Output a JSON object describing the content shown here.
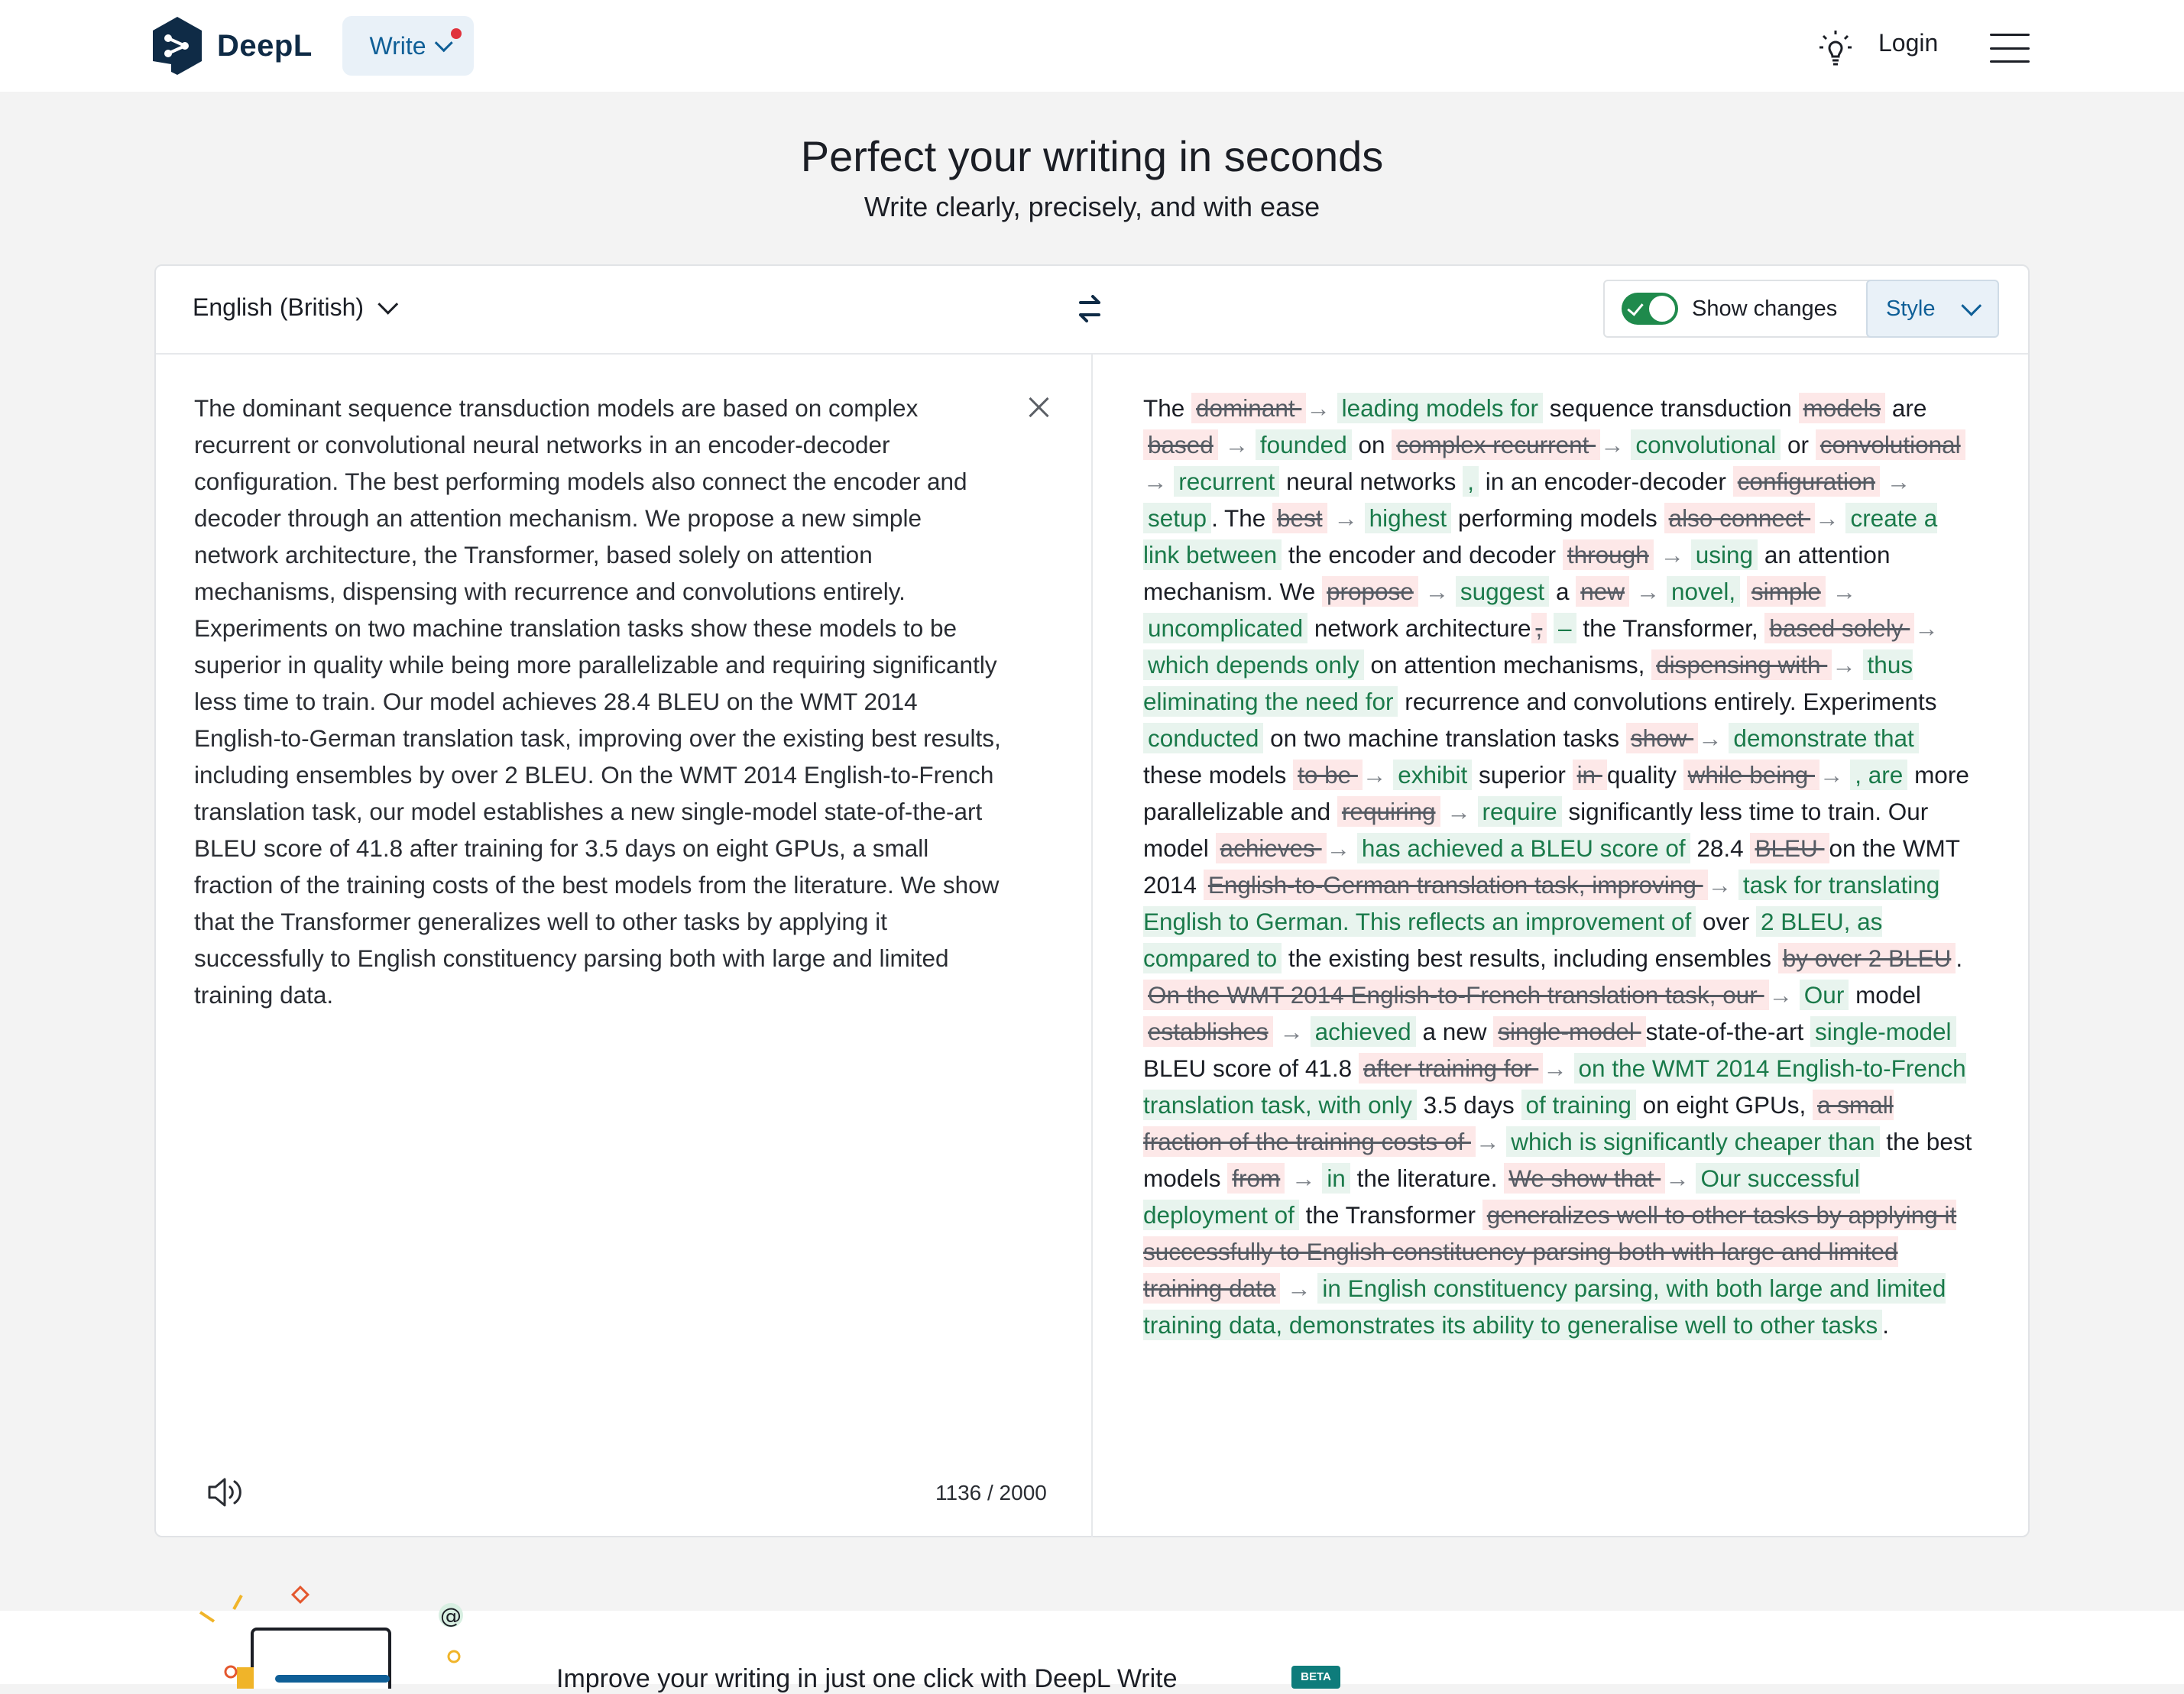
{
  "header": {
    "brand": "DeepL",
    "write_label": "Write",
    "login_label": "Login"
  },
  "hero": {
    "title": "Perfect your writing in seconds",
    "subtitle": "Write clearly, precisely, and with ease"
  },
  "editor": {
    "language": "English (British)",
    "show_changes_label": "Show changes",
    "show_changes_on": true,
    "style_label": "Style",
    "source_text": "The dominant sequence transduction models are based on complex recurrent or convolutional neural networks in an encoder-decoder configuration. The best performing models also connect the encoder and decoder through an attention mechanism. We propose a new simple network architecture, the Transformer, based solely on attention mechanisms, dispensing with recurrence and convolutions entirely. Experiments on two machine translation tasks show these models to be superior in quality while being more parallelizable and requiring significantly less time to train. Our model achieves 28.4 BLEU on the WMT 2014 English-to-German translation task, improving over the existing best results, including ensembles by over 2 BLEU. On the WMT 2014 English-to-French translation task, our model establishes a new single-model state-of-the-art BLEU score of 41.8 after training for 3.5 days on eight GPUs, a small fraction of the training costs of the best models from the literature. We show that the Transformer generalizes well to other tasks by applying it successfully to English constituency parsing both with large and limited training data.",
    "char_count": "1136 / 2000",
    "result_segments": [
      {
        "t": "plain",
        "text": "The "
      },
      {
        "t": "del",
        "text": "dominant "
      },
      {
        "t": "arrow",
        "text": " → "
      },
      {
        "t": "ins",
        "text": "leading models for"
      },
      {
        "t": "plain",
        "text": " sequence transduction "
      },
      {
        "t": "del",
        "text": "models"
      },
      {
        "t": "plain",
        "text": " are "
      },
      {
        "t": "del",
        "text": "based"
      },
      {
        "t": "arrow",
        "text": " → "
      },
      {
        "t": "ins",
        "text": "founded"
      },
      {
        "t": "plain",
        "text": " on "
      },
      {
        "t": "del",
        "text": "complex recurrent "
      },
      {
        "t": "arrow",
        "text": " → "
      },
      {
        "t": "ins",
        "text": "convolutional"
      },
      {
        "t": "plain",
        "text": " or "
      },
      {
        "t": "del",
        "text": "convolutional"
      },
      {
        "t": "arrow",
        "text": " → "
      },
      {
        "t": "ins",
        "text": "recurrent"
      },
      {
        "t": "plain",
        "text": " neural networks "
      },
      {
        "t": "ins",
        "text": ","
      },
      {
        "t": "plain",
        "text": " in an encoder-decoder "
      },
      {
        "t": "del",
        "text": "configuration"
      },
      {
        "t": "arrow",
        "text": " → "
      },
      {
        "t": "ins",
        "text": "setup"
      },
      {
        "t": "plain",
        "text": ". The "
      },
      {
        "t": "del",
        "text": "best"
      },
      {
        "t": "arrow",
        "text": " → "
      },
      {
        "t": "ins",
        "text": "highest"
      },
      {
        "t": "plain",
        "text": " performing models "
      },
      {
        "t": "del",
        "text": "also connect "
      },
      {
        "t": "arrow",
        "text": " → "
      },
      {
        "t": "ins",
        "text": "create a link between"
      },
      {
        "t": "plain",
        "text": " the encoder and decoder "
      },
      {
        "t": "del",
        "text": "through"
      },
      {
        "t": "arrow",
        "text": " → "
      },
      {
        "t": "ins",
        "text": "using"
      },
      {
        "t": "plain",
        "text": " an attention mechanism. We "
      },
      {
        "t": "del",
        "text": "propose"
      },
      {
        "t": "arrow",
        "text": " → "
      },
      {
        "t": "ins",
        "text": "suggest"
      },
      {
        "t": "plain",
        "text": " a "
      },
      {
        "t": "del",
        "text": "new"
      },
      {
        "t": "arrow",
        "text": " → "
      },
      {
        "t": "ins",
        "text": "novel,"
      },
      {
        "t": "plain",
        "text": " "
      },
      {
        "t": "del",
        "text": "simple"
      },
      {
        "t": "arrow",
        "text": " → "
      },
      {
        "t": "ins",
        "text": "uncomplicated"
      },
      {
        "t": "plain",
        "text": " network architecture"
      },
      {
        "t": "del",
        "text": ","
      },
      {
        "t": "plain",
        "text": " "
      },
      {
        "t": "ins",
        "text": "–"
      },
      {
        "t": "plain",
        "text": " the Transformer, "
      },
      {
        "t": "del",
        "text": "based solely "
      },
      {
        "t": "arrow",
        "text": " → "
      },
      {
        "t": "ins",
        "text": "which depends only"
      },
      {
        "t": "plain",
        "text": " on attention mechanisms, "
      },
      {
        "t": "del",
        "text": "dispensing with "
      },
      {
        "t": "arrow",
        "text": " → "
      },
      {
        "t": "ins",
        "text": "thus eliminating the need for"
      },
      {
        "t": "plain",
        "text": " recurrence and convolutions entirely. Experiments "
      },
      {
        "t": "ins",
        "text": "conducted"
      },
      {
        "t": "plain",
        "text": " on two machine translation tasks "
      },
      {
        "t": "del",
        "text": "show "
      },
      {
        "t": "arrow",
        "text": " → "
      },
      {
        "t": "ins",
        "text": "demonstrate that"
      },
      {
        "t": "plain",
        "text": " these models "
      },
      {
        "t": "del",
        "text": "to be "
      },
      {
        "t": "arrow",
        "text": " → "
      },
      {
        "t": "ins",
        "text": "exhibit"
      },
      {
        "t": "plain",
        "text": " superior "
      },
      {
        "t": "del",
        "text": "in "
      },
      {
        "t": "plain",
        "text": " quality "
      },
      {
        "t": "del",
        "text": "while being "
      },
      {
        "t": "arrow",
        "text": " → "
      },
      {
        "t": "ins",
        "text": ", are"
      },
      {
        "t": "plain",
        "text": " more parallelizable and "
      },
      {
        "t": "del",
        "text": "requiring"
      },
      {
        "t": "arrow",
        "text": " → "
      },
      {
        "t": "ins",
        "text": "require"
      },
      {
        "t": "plain",
        "text": " significantly less time to train. Our model "
      },
      {
        "t": "del",
        "text": "achieves "
      },
      {
        "t": "arrow",
        "text": " → "
      },
      {
        "t": "ins",
        "text": "has achieved a BLEU score of"
      },
      {
        "t": "plain",
        "text": " 28.4 "
      },
      {
        "t": "del",
        "text": "BLEU "
      },
      {
        "t": "plain",
        "text": "on the WMT 2014 "
      },
      {
        "t": "del",
        "text": "English-to-German translation task, improving "
      },
      {
        "t": "arrow",
        "text": " → "
      },
      {
        "t": "ins",
        "text": "task for translating English to German. This reflects an improvement of"
      },
      {
        "t": "plain",
        "text": " over "
      },
      {
        "t": "ins",
        "text": "2 BLEU, as compared to"
      },
      {
        "t": "plain",
        "text": " the existing best results, including ensembles "
      },
      {
        "t": "del",
        "text": "by over 2 BLEU"
      },
      {
        "t": "plain",
        "text": ". "
      },
      {
        "t": "del",
        "text": "On the WMT 2014 English-to-French translation task, our "
      },
      {
        "t": "arrow",
        "text": " → "
      },
      {
        "t": "ins",
        "text": "Our"
      },
      {
        "t": "plain",
        "text": " model "
      },
      {
        "t": "del",
        "text": "establishes"
      },
      {
        "t": "arrow",
        "text": " → "
      },
      {
        "t": "ins",
        "text": "achieved"
      },
      {
        "t": "plain",
        "text": " a new "
      },
      {
        "t": "del",
        "text": "single-model "
      },
      {
        "t": "plain",
        "text": "state-of-the-art "
      },
      {
        "t": "ins",
        "text": "single-model"
      },
      {
        "t": "plain",
        "text": " BLEU score of 41.8 "
      },
      {
        "t": "del",
        "text": "after training for "
      },
      {
        "t": "arrow",
        "text": " → "
      },
      {
        "t": "ins",
        "text": "on the WMT 2014 English-to-French translation task, with only"
      },
      {
        "t": "plain",
        "text": " 3.5 days "
      },
      {
        "t": "ins",
        "text": "of training"
      },
      {
        "t": "plain",
        "text": " on eight GPUs, "
      },
      {
        "t": "del",
        "text": "a small fraction of the training costs of "
      },
      {
        "t": "arrow",
        "text": " → "
      },
      {
        "t": "ins",
        "text": "which is significantly cheaper than"
      },
      {
        "t": "plain",
        "text": " the best models "
      },
      {
        "t": "del",
        "text": "from"
      },
      {
        "t": "arrow",
        "text": " → "
      },
      {
        "t": "ins",
        "text": "in"
      },
      {
        "t": "plain",
        "text": " the literature. "
      },
      {
        "t": "del",
        "text": "We show that "
      },
      {
        "t": "arrow",
        "text": " → "
      },
      {
        "t": "ins",
        "text": "Our successful deployment of"
      },
      {
        "t": "plain",
        "text": " the Transformer "
      },
      {
        "t": "del",
        "text": "generalizes well to other tasks by applying it successfully to English constituency parsing both with large and limited training data"
      },
      {
        "t": "arrow",
        "text": " → "
      },
      {
        "t": "ins",
        "text": "in English constituency parsing, with both large and limited training data, demonstrates its ability to generalise well to other tasks"
      },
      {
        "t": "plain",
        "text": "."
      }
    ]
  },
  "promo": {
    "text": "Improve your writing in just one click with DeepL Write",
    "badge": "BETA"
  },
  "colors": {
    "brand": "#0f2b46",
    "accent": "#0f5f97",
    "insert": "#1a7a4a",
    "delete_bg": "#fde8e8",
    "toggle": "#1f8a4c"
  },
  "icons": [
    "deepl-logo-icon",
    "chevron-down-icon",
    "notification-dot-icon",
    "lightbulb-icon",
    "hamburger-menu-icon",
    "swap-arrows-icon",
    "check-icon",
    "close-icon",
    "speaker-icon"
  ]
}
